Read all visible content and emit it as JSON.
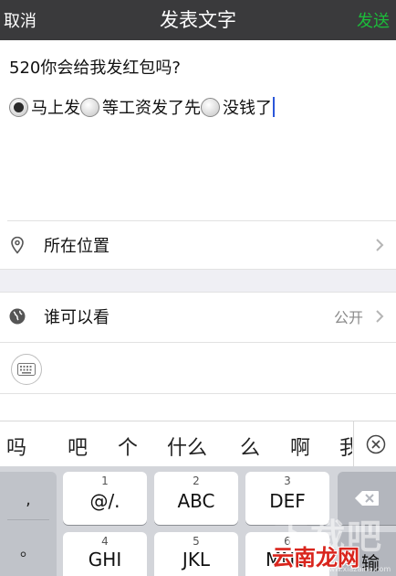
{
  "header": {
    "cancel_label": "取消",
    "title": "发表文字",
    "send_label": "发送",
    "send_color": "#1bbd3a"
  },
  "compose": {
    "text": "520你会给我发红包吗?",
    "options": [
      {
        "label": "马上发",
        "selected": true
      },
      {
        "label": "等工资发了先",
        "selected": false
      },
      {
        "label": "没钱了",
        "selected": false
      }
    ]
  },
  "location_row": {
    "icon": "location-pin-icon",
    "label": "所在位置"
  },
  "visibility_row": {
    "icon": "globe-icon",
    "label": "谁可以看",
    "value": "公开"
  },
  "candidates": {
    "items": [
      "吗",
      "吧",
      "个",
      "什么",
      "么",
      "啊",
      "我"
    ],
    "close_icon": "close-circle-icon"
  },
  "keyboard": {
    "side_keys": [
      ",",
      "。"
    ],
    "keys_row1": [
      {
        "num": "1",
        "letters": "@/."
      },
      {
        "num": "2",
        "letters": "ABC"
      },
      {
        "num": "3",
        "letters": "DEF"
      }
    ],
    "keys_row2": [
      {
        "num": "4",
        "letters": "GHI"
      },
      {
        "num": "5",
        "letters": "JKL"
      },
      {
        "num": "6",
        "letters": "MNO"
      }
    ],
    "delete_icon": "backspace-icon",
    "enter_label": "输"
  },
  "watermark": {
    "text": "云南龙网",
    "faint_text": "下载吧",
    "url": "www.xiazaiba.com"
  }
}
